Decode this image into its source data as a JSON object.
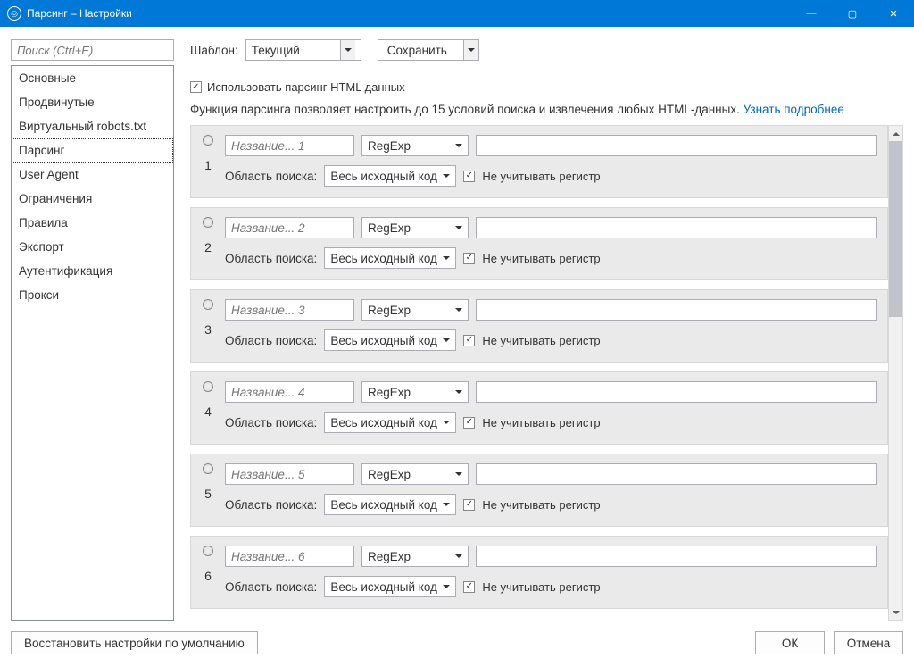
{
  "window": {
    "title": "Парсинг – Настройки",
    "icon_label": "app-icon"
  },
  "sidebar": {
    "search_placeholder": "Поиск (Ctrl+E)",
    "items": [
      {
        "label": "Основные"
      },
      {
        "label": "Продвинутые"
      },
      {
        "label": "Виртуальный robots.txt"
      },
      {
        "label": "Парсинг"
      },
      {
        "label": "User Agent"
      },
      {
        "label": "Ограничения"
      },
      {
        "label": "Правила"
      },
      {
        "label": "Экспорт"
      },
      {
        "label": "Аутентификация"
      },
      {
        "label": "Прокси"
      }
    ],
    "selected_index": 3
  },
  "top": {
    "template_label": "Шаблон:",
    "template_value": "Текущий",
    "save_label": "Сохранить"
  },
  "enable_check_label": "Использовать парсинг HTML данных",
  "description_text": "Функция парсинга позволяет настроить до 15 условий поиска и извлечения любых HTML-данных.",
  "description_link": "Узнать подробнее",
  "rule_labels": {
    "name_placeholder_prefix": "Название...",
    "method": "RegExp",
    "scope_label": "Область поиска:",
    "scope_value": "Весь исходный код",
    "case_label": "Не учитывать регистр"
  },
  "rules": [
    {
      "n": "1"
    },
    {
      "n": "2"
    },
    {
      "n": "3"
    },
    {
      "n": "4"
    },
    {
      "n": "5"
    },
    {
      "n": "6"
    }
  ],
  "footer": {
    "reset": "Восстановить настройки по умолчанию",
    "ok": "ОК",
    "cancel": "Отмена"
  }
}
